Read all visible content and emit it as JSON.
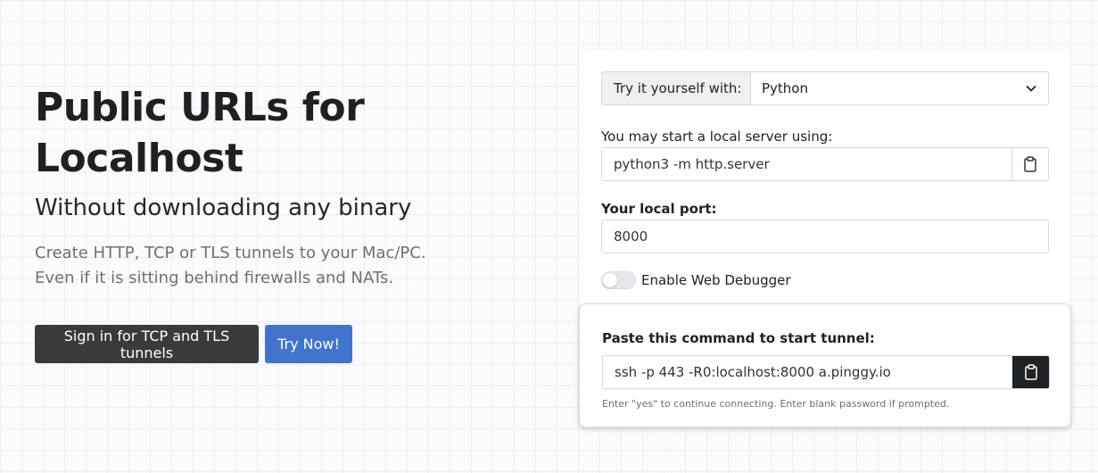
{
  "hero": {
    "title_line1": "Public URLs for",
    "title_line2": "Localhost",
    "subtitle": "Without downloading any binary",
    "desc_line1": "Create HTTP, TCP or TLS tunnels to your Mac/PC.",
    "desc_line2": "Even if it is sitting behind firewalls and NATs.",
    "signin_label": "Sign in for TCP and TLS tunnels",
    "try_label": "Try Now!"
  },
  "config": {
    "try_label": "Try it yourself with:",
    "language": "Python",
    "server_label": "You may start a local server using:",
    "server_command": "python3 -m http.server",
    "port_label": "Your local port:",
    "port_value": "8000",
    "debugger_label": "Enable Web Debugger",
    "debugger_enabled": false
  },
  "tunnel": {
    "label": "Paste this command to start tunnel:",
    "command": "ssh -p 443 -R0:localhost:8000 a.pinggy.io",
    "hint": "Enter \"yes\" to continue connecting. Enter blank password if prompted."
  },
  "icons": {
    "dropdown": "chevron-down-icon",
    "copy": "clipboard-icon"
  },
  "colors": {
    "primary_dark": "#393a3b",
    "primary_blue": "#4274cf",
    "copy_dark": "#1f2225"
  }
}
